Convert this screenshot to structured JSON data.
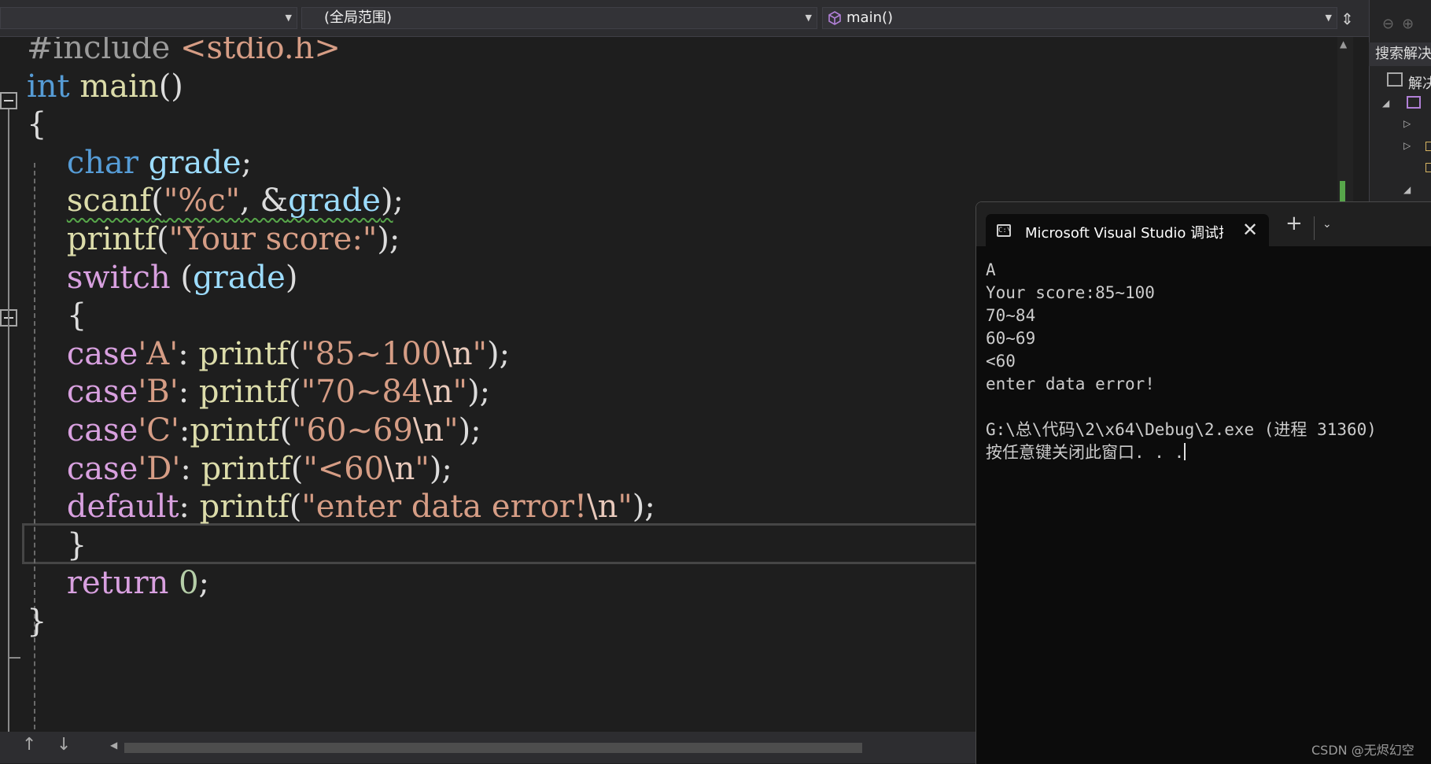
{
  "navbar": {
    "project_combo": "",
    "scope_combo": "(全局范围)",
    "member_combo": "main()"
  },
  "code_lines": [
    {
      "segments": [
        [
          "pp",
          "#include "
        ],
        [
          "inc",
          "<stdio.h>"
        ]
      ]
    },
    {
      "segments": [
        [
          "kw",
          "int"
        ],
        [
          "punct",
          " "
        ],
        [
          "fn",
          "main"
        ],
        [
          "punct",
          "()"
        ]
      ]
    },
    {
      "segments": [
        [
          "punct",
          "{"
        ]
      ]
    },
    {
      "segments": [
        [
          "punct",
          "    "
        ],
        [
          "kw",
          "char"
        ],
        [
          "punct",
          " "
        ],
        [
          "var",
          "grade"
        ],
        [
          "punct",
          ";"
        ]
      ]
    },
    {
      "segments": [
        [
          "punct",
          "    "
        ],
        [
          "fn squiggle",
          "scanf"
        ],
        [
          "punct squiggle",
          "("
        ],
        [
          "str squiggle",
          "\"%c\""
        ],
        [
          "punct squiggle",
          ", &"
        ],
        [
          "var squiggle",
          "grade"
        ],
        [
          "punct squiggle",
          ")"
        ],
        [
          "punct",
          ";"
        ]
      ]
    },
    {
      "segments": [
        [
          "punct",
          "    "
        ],
        [
          "fn",
          "printf"
        ],
        [
          "punct",
          "("
        ],
        [
          "str",
          "\"Your score:\""
        ],
        [
          "punct",
          ");"
        ]
      ]
    },
    {
      "segments": [
        [
          "punct",
          "    "
        ],
        [
          "ctrl",
          "switch"
        ],
        [
          "punct",
          " ("
        ],
        [
          "var",
          "grade"
        ],
        [
          "punct",
          ")"
        ]
      ]
    },
    {
      "segments": [
        [
          "punct",
          "    {"
        ]
      ]
    },
    {
      "segments": [
        [
          "punct",
          "    "
        ],
        [
          "ctrl",
          "case"
        ],
        [
          "str",
          "'A'"
        ],
        [
          "punct",
          ": "
        ],
        [
          "fn",
          "printf"
        ],
        [
          "punct",
          "("
        ],
        [
          "str",
          "\"85~100"
        ],
        [
          "esc",
          "\\n"
        ],
        [
          "str",
          "\""
        ],
        [
          "punct",
          ");"
        ]
      ]
    },
    {
      "segments": [
        [
          "punct",
          "    "
        ],
        [
          "ctrl",
          "case"
        ],
        [
          "str",
          "'B'"
        ],
        [
          "punct",
          ": "
        ],
        [
          "fn",
          "printf"
        ],
        [
          "punct",
          "("
        ],
        [
          "str",
          "\"70~84"
        ],
        [
          "esc",
          "\\n"
        ],
        [
          "str",
          "\""
        ],
        [
          "punct",
          ");"
        ]
      ]
    },
    {
      "segments": [
        [
          "punct",
          "    "
        ],
        [
          "ctrl",
          "case"
        ],
        [
          "str",
          "'C'"
        ],
        [
          "punct",
          ":"
        ],
        [
          "fn",
          "printf"
        ],
        [
          "punct",
          "("
        ],
        [
          "str",
          "\"60~69"
        ],
        [
          "esc",
          "\\n"
        ],
        [
          "str",
          "\""
        ],
        [
          "punct",
          ");"
        ]
      ]
    },
    {
      "segments": [
        [
          "punct",
          "    "
        ],
        [
          "ctrl",
          "case"
        ],
        [
          "str",
          "'D'"
        ],
        [
          "punct",
          ": "
        ],
        [
          "fn",
          "printf"
        ],
        [
          "punct",
          "("
        ],
        [
          "str",
          "\"<60"
        ],
        [
          "esc",
          "\\n"
        ],
        [
          "str",
          "\""
        ],
        [
          "punct",
          ");"
        ]
      ]
    },
    {
      "segments": [
        [
          "punct",
          "    "
        ],
        [
          "ctrl",
          "default"
        ],
        [
          "punct",
          ": "
        ],
        [
          "fn",
          "printf"
        ],
        [
          "punct",
          "("
        ],
        [
          "str",
          "\"enter data error!"
        ],
        [
          "esc",
          "\\n"
        ],
        [
          "str",
          "\""
        ],
        [
          "punct",
          ");"
        ]
      ]
    },
    {
      "segments": [
        [
          "punct",
          "    }"
        ]
      ]
    },
    {
      "segments": [
        [
          "punct",
          "    "
        ],
        [
          "ctrl",
          "return"
        ],
        [
          "punct",
          " "
        ],
        [
          "num",
          "0"
        ],
        [
          "punct",
          ";"
        ]
      ]
    },
    {
      "segments": [
        [
          "punct",
          "}"
        ]
      ]
    }
  ],
  "explorer": {
    "search_label": "搜索解决",
    "solution_label": "解决"
  },
  "terminal": {
    "tab_title": "Microsoft Visual Studio 调试控制台",
    "icon_text": "C:\\",
    "output_lines": [
      "A",
      "Your score:85~100",
      "70~84",
      "60~69",
      "<60",
      "enter data error!",
      "",
      "G:\\总\\代码\\2\\x64\\Debug\\2.exe (进程 31360)",
      "按任意键关闭此窗口. . ."
    ]
  },
  "icons": {
    "split": "split-editor-icon",
    "close": "close-icon",
    "new_tab": "plus-icon",
    "dropdown": "chevron-down-icon",
    "member": "cube-icon"
  },
  "watermark": "CSDN @无烬幻空"
}
